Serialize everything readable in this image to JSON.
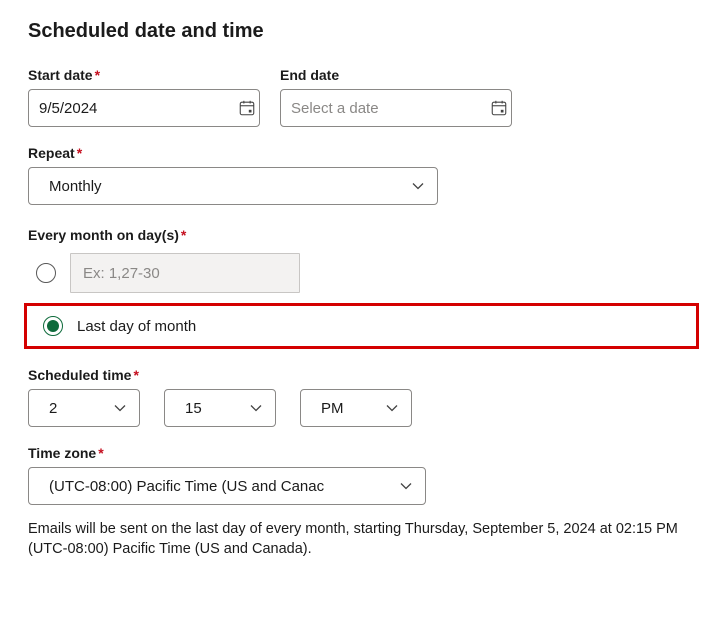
{
  "section_title": "Scheduled date and time",
  "start_date": {
    "label": "Start date",
    "required": true,
    "value": "9/5/2024"
  },
  "end_date": {
    "label": "End date",
    "required": false,
    "placeholder": "Select a date",
    "value": ""
  },
  "repeat": {
    "label": "Repeat",
    "required": true,
    "value": "Monthly"
  },
  "monthly_days": {
    "label": "Every month on day(s)",
    "required": true,
    "placeholder": "Ex: 1,27-30"
  },
  "last_day_option": {
    "label": "Last day of month",
    "selected": true
  },
  "scheduled_time": {
    "label": "Scheduled time",
    "required": true,
    "hour": "2",
    "minute": "15",
    "ampm": "PM"
  },
  "timezone": {
    "label": "Time zone",
    "required": true,
    "value": "(UTC-08:00) Pacific Time (US and Canac"
  },
  "summary": "Emails will be sent on the last day of every month, starting Thursday, September 5, 2024 at 02:15 PM (UTC-08:00) Pacific Time (US and Canada)."
}
